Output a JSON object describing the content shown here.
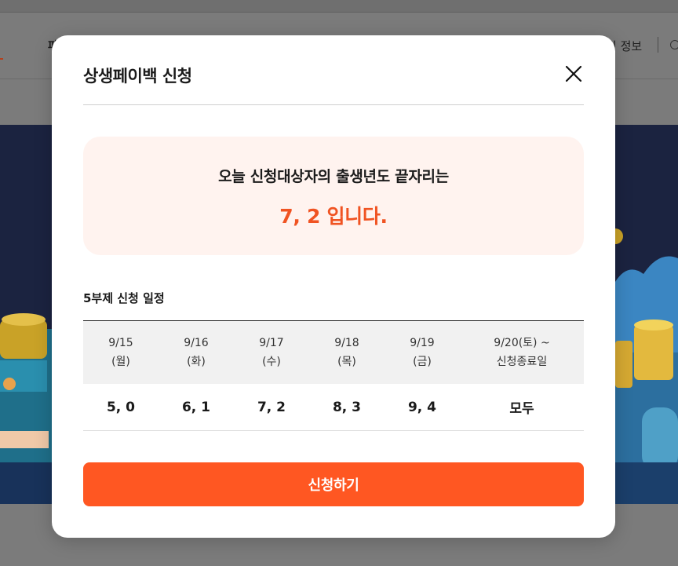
{
  "background": {
    "header_right_text": "비 정보",
    "nav_first_char": "파"
  },
  "modal": {
    "title": "상생페이백 신청",
    "close_icon": "close-icon",
    "notice": {
      "line1": "오늘 신청대상자의 출생년도 끝자리는",
      "line2": "7, 2 입니다.",
      "accent_color": "#f05322"
    },
    "schedule": {
      "title": "5부제 신청 일정",
      "columns": [
        {
          "date": "9/15",
          "day": "(월)",
          "digits": "5, 0"
        },
        {
          "date": "9/16",
          "day": "(화)",
          "digits": "6, 1"
        },
        {
          "date": "9/17",
          "day": "(수)",
          "digits": "7, 2"
        },
        {
          "date": "9/18",
          "day": "(목)",
          "digits": "8, 3"
        },
        {
          "date": "9/19",
          "day": "(금)",
          "digits": "9, 4"
        },
        {
          "date": "9/20(토) ~",
          "day": "신청종료일",
          "digits": "모두"
        }
      ]
    },
    "apply_button": "신청하기",
    "button_color": "#ff5722"
  }
}
